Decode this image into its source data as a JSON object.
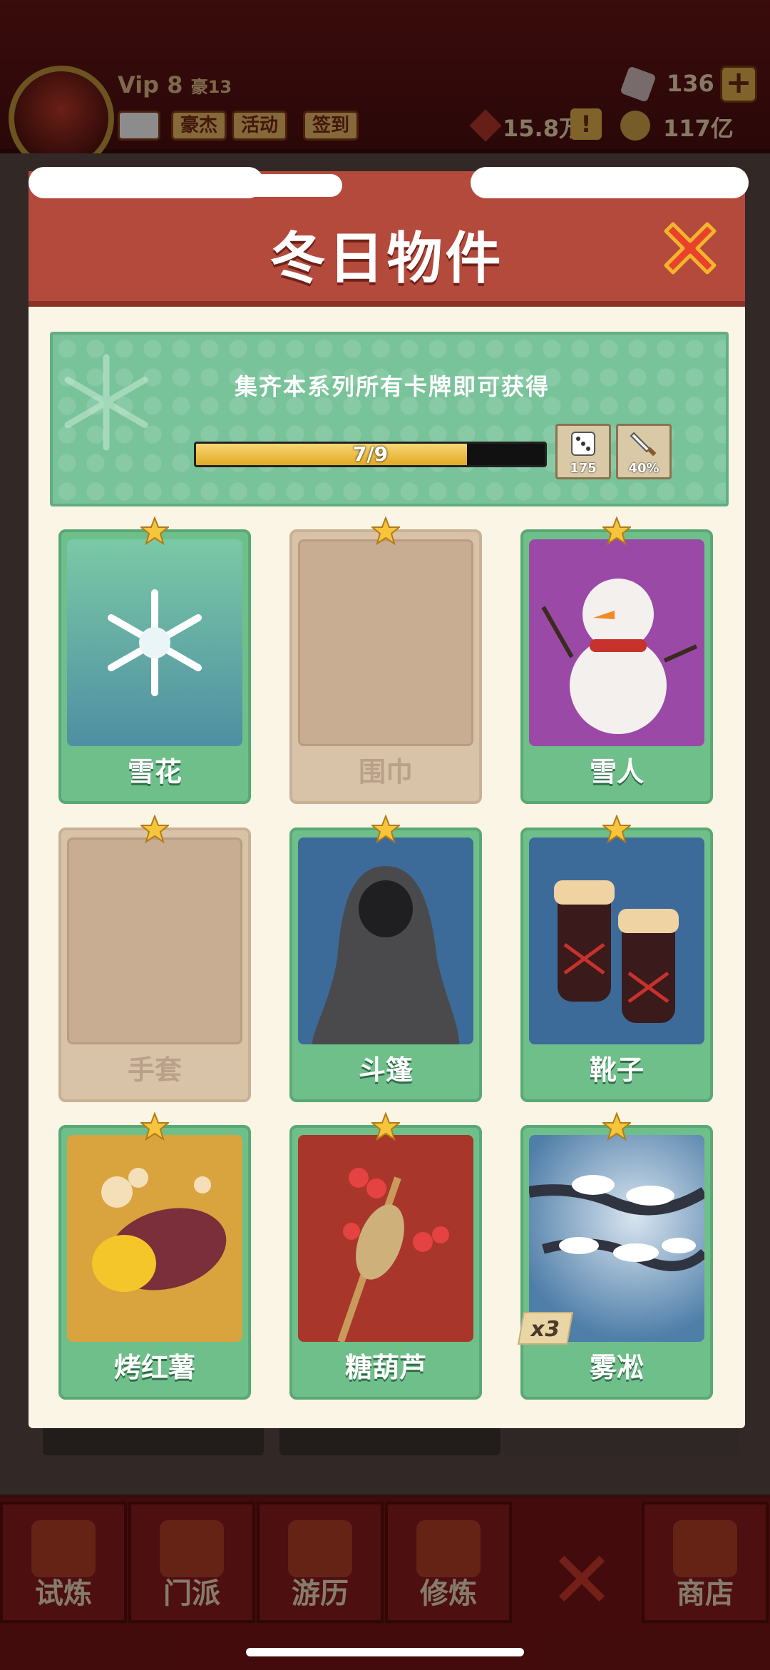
{
  "header": {
    "vip": "Vip 8",
    "vip_sub": "豪13",
    "chips": [
      "豪杰",
      "活动",
      "签到"
    ],
    "gems": "136",
    "plus": "+",
    "power": "15.8万",
    "alert": "!",
    "coins": "117亿"
  },
  "modal": {
    "title": "冬日物件",
    "banner_text": "集齐本系列所有卡牌即可获得",
    "progress_label": "7/9",
    "progress_fraction": 0.7778,
    "rewards": [
      {
        "icon": "dice-icon",
        "value": "175"
      },
      {
        "icon": "sword-icon",
        "value": "40%"
      }
    ],
    "cards": [
      {
        "name": "雪花",
        "collected": true,
        "art": "snowflake"
      },
      {
        "name": "围巾",
        "collected": false,
        "art": "empty"
      },
      {
        "name": "雪人",
        "collected": true,
        "art": "snowman"
      },
      {
        "name": "手套",
        "collected": false,
        "art": "empty"
      },
      {
        "name": "斗篷",
        "collected": true,
        "art": "cloak"
      },
      {
        "name": "靴子",
        "collected": true,
        "art": "boots"
      },
      {
        "name": "烤红薯",
        "collected": true,
        "art": "sweet-potato"
      },
      {
        "name": "糖葫芦",
        "collected": true,
        "art": "candied-haws"
      },
      {
        "name": "雾凇",
        "collected": true,
        "art": "rime",
        "badge": "x3"
      }
    ]
  },
  "bottom_nav": [
    {
      "label": "试炼"
    },
    {
      "label": "门派"
    },
    {
      "label": "游历"
    },
    {
      "label": "修炼"
    },
    {
      "label": "商店"
    }
  ],
  "colors": {
    "header_red": "#b44a3c",
    "card_green": "#6fbf8b",
    "banner_green": "#79c39a",
    "progress_gold": "#e2a924",
    "locked_card": "#d8c2a8"
  }
}
